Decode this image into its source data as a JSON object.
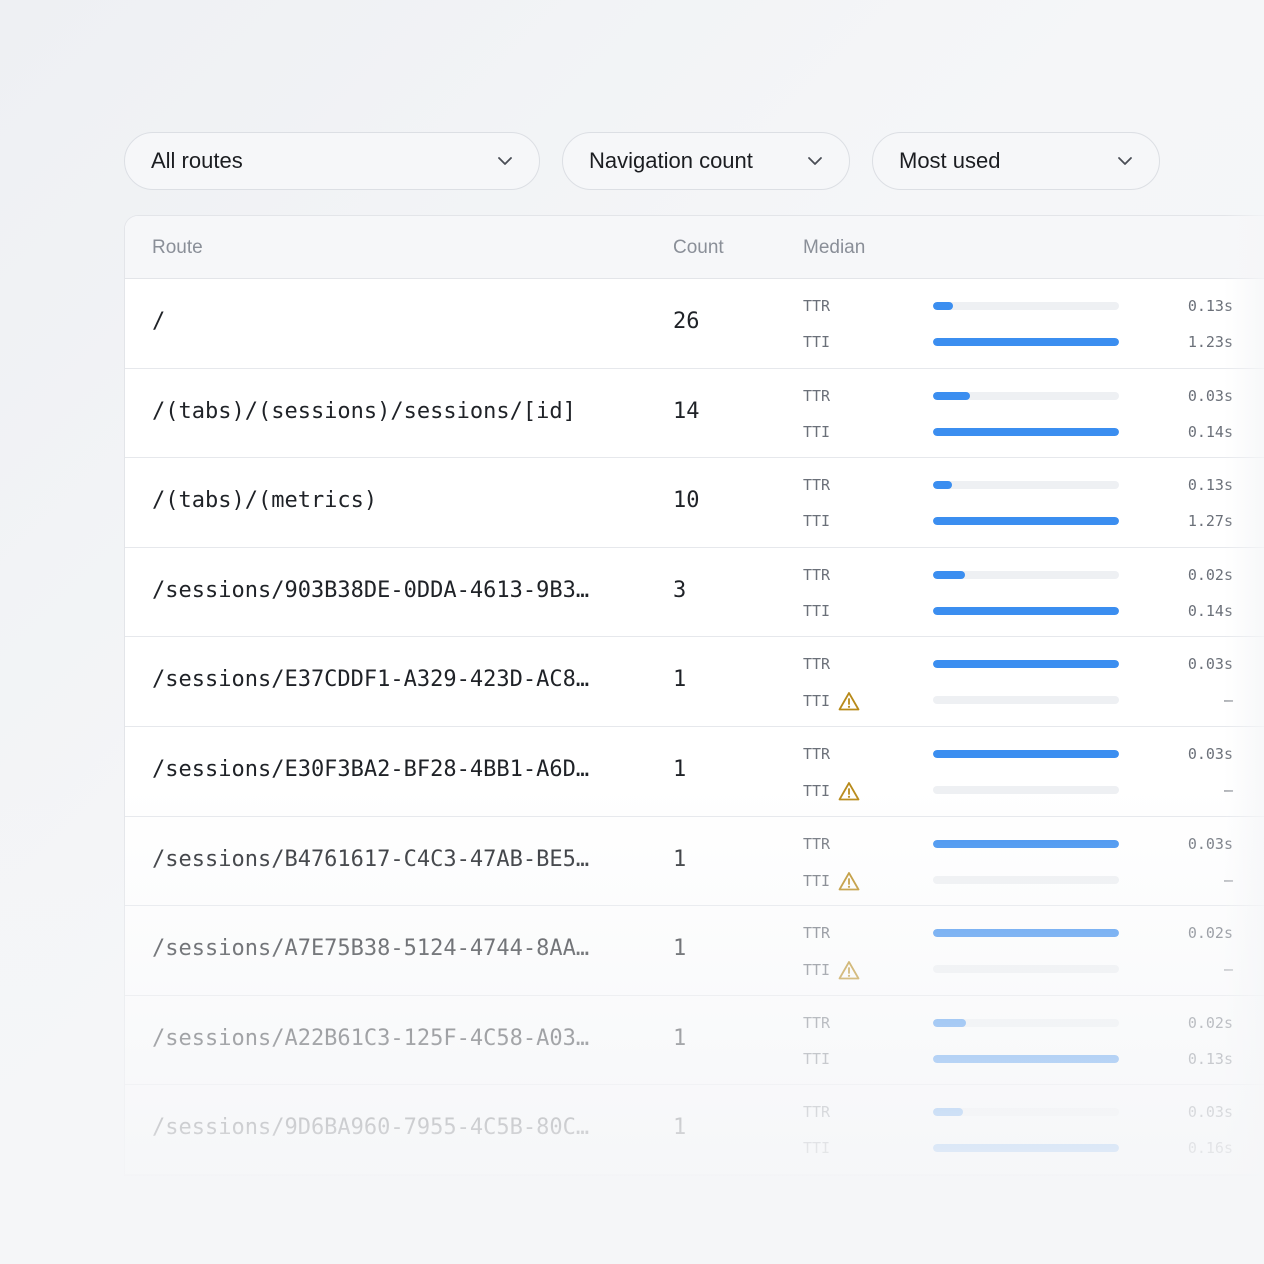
{
  "filters": {
    "route": "All routes",
    "metric": "Navigation count",
    "sort": "Most used"
  },
  "table": {
    "headers": {
      "route": "Route",
      "count": "Count",
      "median": "Median"
    },
    "rows": [
      {
        "route": "/",
        "count": "26",
        "ttr": {
          "label": "TTR",
          "fill": 0.11,
          "value": "0.13s",
          "warn": false
        },
        "tti": {
          "label": "TTI",
          "fill": 1.0,
          "value": "1.23s",
          "warn": false
        }
      },
      {
        "route": "/(tabs)/(sessions)/sessions/[id]",
        "count": "14",
        "ttr": {
          "label": "TTR",
          "fill": 0.2,
          "value": "0.03s",
          "warn": false
        },
        "tti": {
          "label": "TTI",
          "fill": 1.0,
          "value": "0.14s",
          "warn": false
        }
      },
      {
        "route": "/(tabs)/(metrics)",
        "count": "10",
        "ttr": {
          "label": "TTR",
          "fill": 0.1,
          "value": "0.13s",
          "warn": false
        },
        "tti": {
          "label": "TTI",
          "fill": 1.0,
          "value": "1.27s",
          "warn": false
        }
      },
      {
        "route": "/sessions/903B38DE-0DDA-4613-9B3…",
        "count": "3",
        "ttr": {
          "label": "TTR",
          "fill": 0.17,
          "value": "0.02s",
          "warn": false
        },
        "tti": {
          "label": "TTI",
          "fill": 1.0,
          "value": "0.14s",
          "warn": false
        }
      },
      {
        "route": "/sessions/E37CDDF1-A329-423D-AC8…",
        "count": "1",
        "ttr": {
          "label": "TTR",
          "fill": 1.0,
          "value": "0.03s",
          "warn": false
        },
        "tti": {
          "label": "TTI",
          "fill": 0,
          "value": "—",
          "warn": true
        }
      },
      {
        "route": "/sessions/E30F3BA2-BF28-4BB1-A6D…",
        "count": "1",
        "ttr": {
          "label": "TTR",
          "fill": 1.0,
          "value": "0.03s",
          "warn": false
        },
        "tti": {
          "label": "TTI",
          "fill": 0,
          "value": "—",
          "warn": true
        }
      },
      {
        "route": "/sessions/B4761617-C4C3-47AB-BE5…",
        "count": "1",
        "ttr": {
          "label": "TTR",
          "fill": 1.0,
          "value": "0.03s",
          "warn": false
        },
        "tti": {
          "label": "TTI",
          "fill": 0,
          "value": "—",
          "warn": true
        }
      },
      {
        "route": "/sessions/A7E75B38-5124-4744-8AA…",
        "count": "1",
        "ttr": {
          "label": "TTR",
          "fill": 1.0,
          "value": "0.02s",
          "warn": false
        },
        "tti": {
          "label": "TTI",
          "fill": 0,
          "value": "—",
          "warn": true
        }
      },
      {
        "route": "/sessions/A22B61C3-125F-4C58-A03…",
        "count": "1",
        "ttr": {
          "label": "TTR",
          "fill": 0.18,
          "value": "0.02s",
          "warn": false
        },
        "tti": {
          "label": "TTI",
          "fill": 1.0,
          "value": "0.13s",
          "warn": false
        }
      },
      {
        "route": "/sessions/9D6BA960-7955-4C5B-80C…",
        "count": "1",
        "ttr": {
          "label": "TTR",
          "fill": 0.16,
          "value": "0.03s",
          "warn": false
        },
        "tti": {
          "label": "TTI",
          "fill": 1.0,
          "value": "0.16s",
          "warn": false
        }
      }
    ]
  },
  "colors": {
    "bar": "#3b8ef0",
    "track": "#eef0f3",
    "warning": "#b88a1a"
  },
  "icons": {
    "dropdown": "chevron-down-icon",
    "warning": "warning-triangle-icon"
  }
}
